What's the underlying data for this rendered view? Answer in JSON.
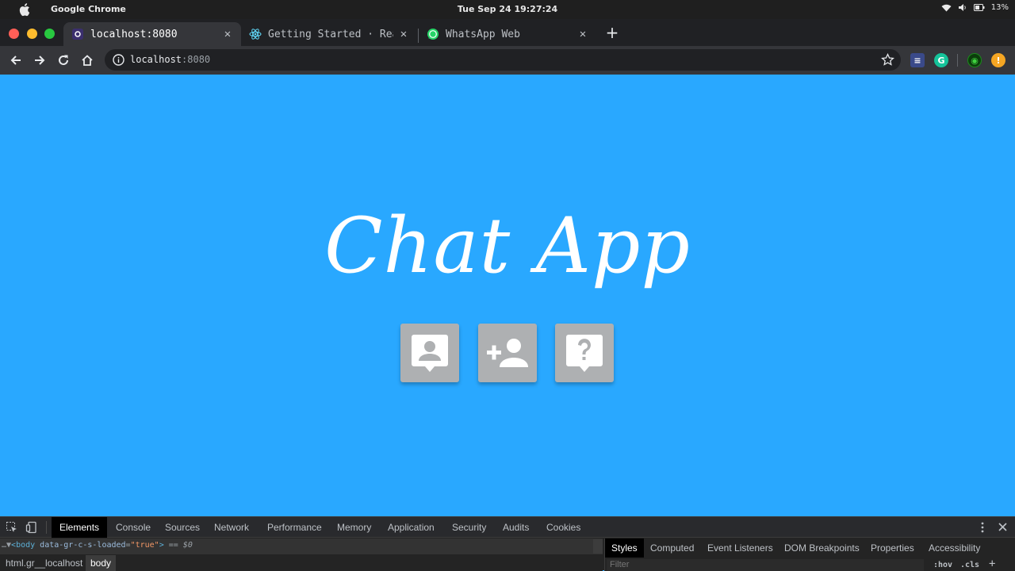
{
  "os_bar": {
    "app_name": "Google Chrome",
    "clock": "Tue Sep 24  19:27:24",
    "battery": "13%"
  },
  "tabs": [
    {
      "title": "localhost:8080",
      "icon": "vue-icon"
    },
    {
      "title": "Getting Started · React",
      "icon": "react-icon"
    },
    {
      "title": "WhatsApp Web",
      "icon": "whatsapp-icon"
    }
  ],
  "address_bar": {
    "host": "localhost",
    "port": ":8080"
  },
  "page": {
    "title": "Chat App",
    "buttons": [
      {
        "name": "contact-card-button",
        "icon": "account-box-icon"
      },
      {
        "name": "add-user-button",
        "icon": "person-add-icon"
      },
      {
        "name": "help-button",
        "icon": "help-icon"
      }
    ],
    "background": "#29a8ff",
    "button_color": "#aeb0b2"
  },
  "devtools": {
    "tabs": [
      "Elements",
      "Console",
      "Sources",
      "Network",
      "Performance",
      "Memory",
      "Application",
      "Security",
      "Audits",
      "Cookies"
    ],
    "dom_line": {
      "prefix": "…▼",
      "tag_open": "<body",
      "attr": " data-gr-c-s-loaded",
      "eq_sign": "=",
      "value": "\"true\"",
      "tag_close": ">",
      "selected_marker": " == $0"
    },
    "breadcrumbs": [
      "html.gr__localhost",
      "body"
    ],
    "side_tabs": [
      "Styles",
      "Computed",
      "Event Listeners",
      "DOM Breakpoints",
      "Properties",
      "Accessibility"
    ],
    "filter_placeholder": "Filter",
    "hov_label": ":hov",
    "cls_label": ".cls",
    "add_label": "+"
  }
}
